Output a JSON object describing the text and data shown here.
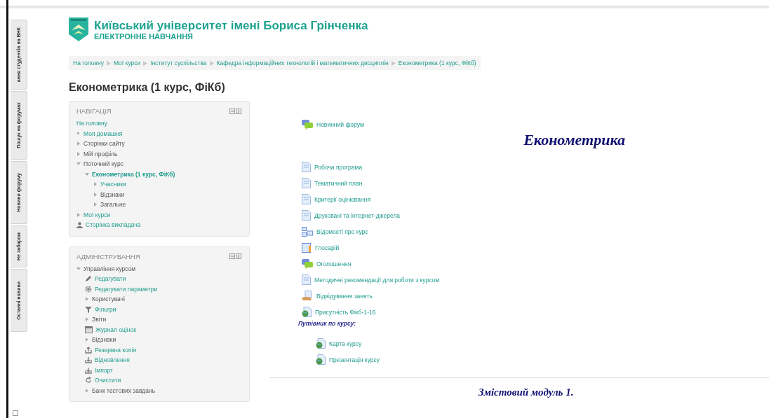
{
  "side_tabs": [
    "ання студентів на ВНК",
    "Пошук на форумах",
    "Новини форуму",
    "Не забаром",
    "Останні новини"
  ],
  "header": {
    "title": "Київський університет імені Бориса Грінченка",
    "subtitle": "ЕЛЕКТРОННЕ НАВЧАННЯ"
  },
  "breadcrumb": [
    "На головну",
    "Мої курси",
    "Інститут суспільства",
    "Кафедра інформаційних технологій і математичних дисциплін",
    "Економетрика (1 курс, ФіКб)"
  ],
  "page_title": "Економетрика (1 курс, ФіКб)",
  "navigation": {
    "title": "НАВІГАЦІЯ",
    "items": [
      {
        "label": "На головну",
        "kind": "plain",
        "link": true
      },
      {
        "label": "Моя домашня",
        "kind": "leaf",
        "link": true
      },
      {
        "label": "Сторінки сайту",
        "kind": "branch",
        "link": false,
        "expanded": false
      },
      {
        "label": "Мій профіль",
        "kind": "branch",
        "link": false,
        "expanded": false
      },
      {
        "label": "Поточний курс",
        "kind": "branch",
        "link": false,
        "expanded": true,
        "children": [
          {
            "label": "Економетрика (1 курс, ФіКб)",
            "kind": "branch",
            "link": true,
            "current": true,
            "expanded": true,
            "children": [
              {
                "label": "Учасники",
                "kind": "branch",
                "link": true,
                "expanded": false
              },
              {
                "label": "Відзнаки",
                "kind": "branch",
                "link": false,
                "expanded": false
              },
              {
                "label": "Загальне",
                "kind": "branch",
                "link": false,
                "expanded": false
              }
            ]
          }
        ]
      },
      {
        "label": "Мої курси",
        "kind": "branch",
        "link": true,
        "expanded": false
      },
      {
        "label": "Сторінка викладача",
        "kind": "person",
        "link": true
      }
    ]
  },
  "administration": {
    "title": "АДМІНІСТРУВАННЯ",
    "items": [
      {
        "label": "Управління курсом",
        "kind": "branch",
        "link": false,
        "expanded": true,
        "children": [
          {
            "label": "Редагувати",
            "kind": "edit",
            "link": true
          },
          {
            "label": "Редагувати параметри",
            "kind": "gear",
            "link": true
          },
          {
            "label": "Користувачі",
            "kind": "branch",
            "link": false,
            "expanded": false
          },
          {
            "label": "Фільтри",
            "kind": "filter",
            "link": true
          },
          {
            "label": "Звіти",
            "kind": "branch",
            "link": false,
            "expanded": false
          },
          {
            "label": "Журнал оцінок",
            "kind": "grades",
            "link": true
          },
          {
            "label": "Відзнаки",
            "kind": "branch",
            "link": false,
            "expanded": false
          },
          {
            "label": "Резервна копія",
            "kind": "backup",
            "link": true
          },
          {
            "label": "Відновлення",
            "kind": "restore",
            "link": true
          },
          {
            "label": "Імпорт",
            "kind": "restore",
            "link": true
          },
          {
            "label": "Очистити",
            "kind": "reset",
            "link": true
          },
          {
            "label": "Банк тестових завдань",
            "kind": "branch",
            "link": false,
            "expanded": false
          }
        ]
      }
    ]
  },
  "course": {
    "news": {
      "label": "Новинний форум",
      "kind": "forum"
    },
    "title": "Економетрика",
    "activities": [
      {
        "label": "Робоча програма",
        "kind": "page"
      },
      {
        "label": "Тематичний план",
        "kind": "page"
      },
      {
        "label": "Критерії оцінювання",
        "kind": "page"
      },
      {
        "label": "Друковані та інтернет-джерела",
        "kind": "page"
      },
      {
        "label": "Відомості про курс",
        "kind": "folder"
      },
      {
        "label": "Глосарій",
        "kind": "glossary"
      },
      {
        "label": "Оголошення",
        "kind": "forum"
      },
      {
        "label": "Методичні рекомендації для роботи з курсом",
        "kind": "page"
      },
      {
        "label": "Відвідування занять",
        "kind": "attendance"
      },
      {
        "label": "Присутність Фікб-1-16",
        "kind": "url"
      }
    ],
    "guide_label": "Путівник по курсу:",
    "guide": [
      {
        "label": "Карта курсу",
        "kind": "url"
      },
      {
        "label": "Презентація курсу",
        "kind": "url"
      }
    ],
    "module_title": "Змістовий модуль 1."
  }
}
